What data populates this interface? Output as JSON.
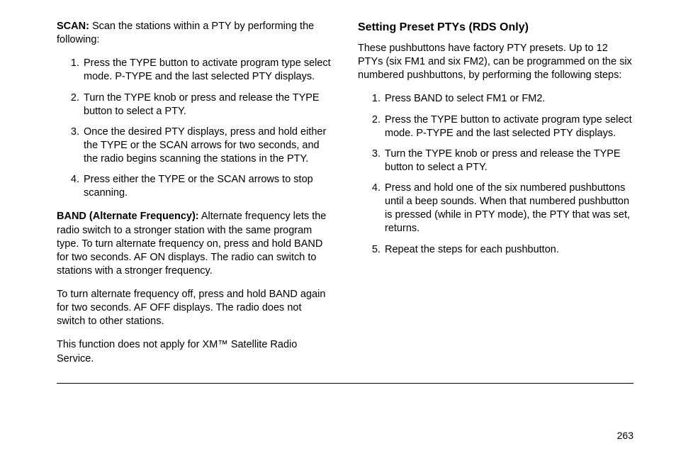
{
  "left": {
    "scan_label": "SCAN:",
    "scan_intro": " Scan the stations within a PTY by performing the following:",
    "scan_steps": [
      "Press the TYPE button to activate program type select mode. P-TYPE and the last selected PTY displays.",
      "Turn the TYPE knob or press and release the TYPE button to select a PTY.",
      "Once the desired PTY displays, press and hold either the TYPE or the SCAN arrows for two seconds, and the radio begins scanning the stations in the PTY.",
      "Press either the TYPE or the SCAN arrows to stop scanning."
    ],
    "band_label": "BAND (Alternate Frequency):",
    "band_text": " Alternate frequency lets the radio switch to a stronger station with the same program type. To turn alternate frequency on, press and hold BAND for two seconds. AF ON displays. The radio can switch to stations with a stronger frequency.",
    "band_off": "To turn alternate frequency off, press and hold BAND again for two seconds. AF OFF displays. The radio does not switch to other stations.",
    "xm_note": "This function does not apply for XM™ Satellite Radio Service."
  },
  "right": {
    "heading": "Setting Preset PTYs (RDS Only)",
    "intro": "These pushbuttons have factory PTY presets. Up to 12 PTYs (six FM1 and six FM2), can be programmed on the six numbered pushbuttons, by performing the following steps:",
    "steps": [
      "Press BAND to select FM1 or FM2.",
      "Press the TYPE button to activate program type select mode. P-TYPE and the last selected PTY displays.",
      "Turn the TYPE knob or press and release the TYPE button to select a PTY.",
      "Press and hold one of the six numbered pushbuttons until a beep sounds. When that numbered pushbutton is pressed (while in PTY mode), the PTY that was set, returns.",
      "Repeat the steps for each pushbutton."
    ]
  },
  "page_number": "263"
}
